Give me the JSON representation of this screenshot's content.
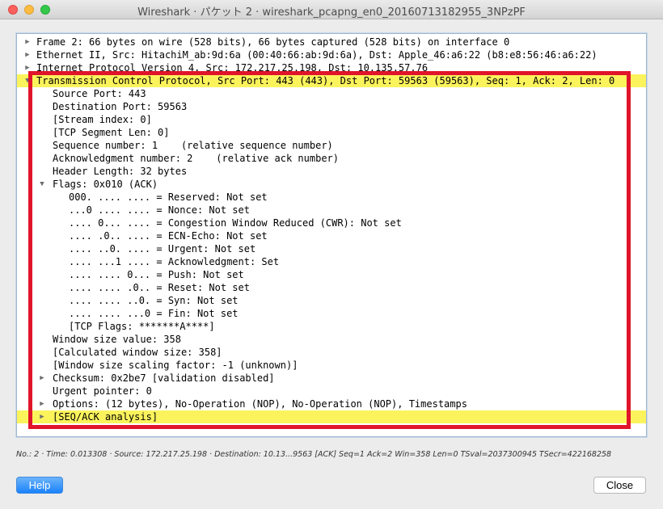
{
  "window": {
    "title": "Wireshark · パケット 2 · wireshark_pcapng_en0_20160713182955_3NPzPF"
  },
  "tree": {
    "rows": [
      {
        "indent": 0,
        "arrow": "▶",
        "text": "Frame 2: 66 bytes on wire (528 bits), 66 bytes captured (528 bits) on interface 0",
        "highlight": false
      },
      {
        "indent": 0,
        "arrow": "▶",
        "text": "Ethernet II, Src: HitachiM_ab:9d:6a (00:40:66:ab:9d:6a), Dst: Apple_46:a6:22 (b8:e8:56:46:a6:22)",
        "highlight": false
      },
      {
        "indent": 0,
        "arrow": "▶",
        "text": "Internet Protocol Version 4, Src: 172.217.25.198, Dst: 10.135.57.76",
        "highlight": false
      },
      {
        "indent": 0,
        "arrow": "▼",
        "text": "Transmission Control Protocol, Src Port: 443 (443), Dst Port: 59563 (59563), Seq: 1, Ack: 2, Len: 0",
        "highlight": true
      },
      {
        "indent": 1,
        "arrow": "",
        "text": "Source Port: 443",
        "highlight": false
      },
      {
        "indent": 1,
        "arrow": "",
        "text": "Destination Port: 59563",
        "highlight": false
      },
      {
        "indent": 1,
        "arrow": "",
        "text": "[Stream index: 0]",
        "highlight": false
      },
      {
        "indent": 1,
        "arrow": "",
        "text": "[TCP Segment Len: 0]",
        "highlight": false
      },
      {
        "indent": 1,
        "arrow": "",
        "text": "Sequence number: 1    (relative sequence number)",
        "highlight": false
      },
      {
        "indent": 1,
        "arrow": "",
        "text": "Acknowledgment number: 2    (relative ack number)",
        "highlight": false
      },
      {
        "indent": 1,
        "arrow": "",
        "text": "Header Length: 32 bytes",
        "highlight": false
      },
      {
        "indent": 1,
        "arrow": "▼",
        "text": "Flags: 0x010 (ACK)",
        "highlight": false
      },
      {
        "indent": 2,
        "arrow": "",
        "text": "000. .... .... = Reserved: Not set",
        "highlight": false
      },
      {
        "indent": 2,
        "arrow": "",
        "text": "...0 .... .... = Nonce: Not set",
        "highlight": false
      },
      {
        "indent": 2,
        "arrow": "",
        "text": ".... 0... .... = Congestion Window Reduced (CWR): Not set",
        "highlight": false
      },
      {
        "indent": 2,
        "arrow": "",
        "text": ".... .0.. .... = ECN-Echo: Not set",
        "highlight": false
      },
      {
        "indent": 2,
        "arrow": "",
        "text": ".... ..0. .... = Urgent: Not set",
        "highlight": false
      },
      {
        "indent": 2,
        "arrow": "",
        "text": ".... ...1 .... = Acknowledgment: Set",
        "highlight": false
      },
      {
        "indent": 2,
        "arrow": "",
        "text": ".... .... 0... = Push: Not set",
        "highlight": false
      },
      {
        "indent": 2,
        "arrow": "",
        "text": ".... .... .0.. = Reset: Not set",
        "highlight": false
      },
      {
        "indent": 2,
        "arrow": "",
        "text": ".... .... ..0. = Syn: Not set",
        "highlight": false
      },
      {
        "indent": 2,
        "arrow": "",
        "text": ".... .... ...0 = Fin: Not set",
        "highlight": false
      },
      {
        "indent": 2,
        "arrow": "",
        "text": "[TCP Flags: *******A****]",
        "highlight": false
      },
      {
        "indent": 1,
        "arrow": "",
        "text": "Window size value: 358",
        "highlight": false
      },
      {
        "indent": 1,
        "arrow": "",
        "text": "[Calculated window size: 358]",
        "highlight": false
      },
      {
        "indent": 1,
        "arrow": "",
        "text": "[Window size scaling factor: -1 (unknown)]",
        "highlight": false
      },
      {
        "indent": 1,
        "arrow": "▶",
        "text": "Checksum: 0x2be7 [validation disabled]",
        "highlight": false
      },
      {
        "indent": 1,
        "arrow": "",
        "text": "Urgent pointer: 0",
        "highlight": false
      },
      {
        "indent": 1,
        "arrow": "▶",
        "text": "Options: (12 bytes), No-Operation (NOP), No-Operation (NOP), Timestamps",
        "highlight": false
      },
      {
        "indent": 1,
        "arrow": "▶",
        "text": "[SEQ/ACK analysis]",
        "highlight": true
      }
    ]
  },
  "status": {
    "text": "No.: 2 · Time: 0.013308 · Source: 172.217.25.198 · Destination: 10.13...9563 [ACK] Seq=1 Ack=2 Win=358 Len=0 TSval=2037300945 TSecr=422168258"
  },
  "buttons": {
    "help_label": "Help",
    "close_label": "Close"
  },
  "colors": {
    "highlight": "#fbf35c",
    "annotation_box": "#e0142a",
    "help_button": "#1a82fb"
  }
}
